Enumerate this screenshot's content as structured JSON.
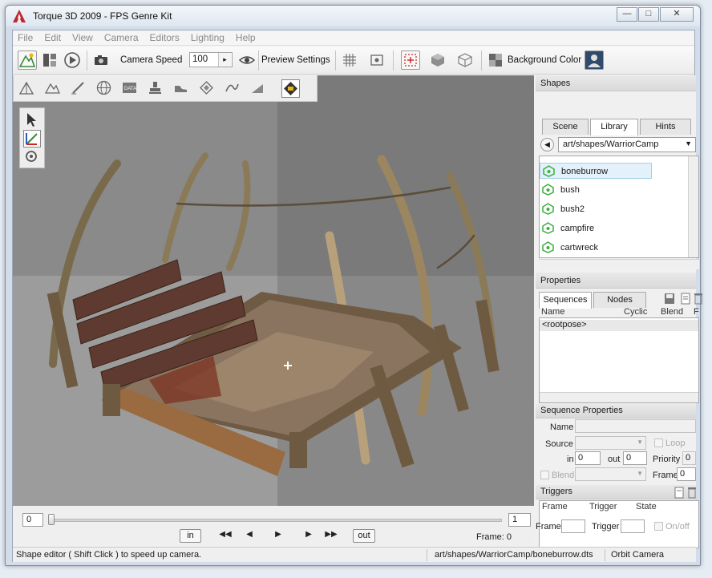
{
  "window": {
    "title": "Torque 3D 2009 - FPS Genre Kit"
  },
  "menu": [
    "File",
    "Edit",
    "View",
    "Camera",
    "Editors",
    "Lighting",
    "Help"
  ],
  "toolbar": {
    "camera_speed_label": "Camera Speed",
    "camera_speed_value": "100",
    "preview_settings_label": "Preview Settings",
    "background_color_label": "Background Color"
  },
  "shapes_panel": {
    "title": "Shapes",
    "tabs": [
      "Scene",
      "Library",
      "Hints"
    ],
    "active_tab": "Library",
    "path": "art/shapes/WarriorCamp",
    "items": [
      "boneburrow",
      "bush",
      "bush2",
      "campfire",
      "cartwreck"
    ],
    "selected": "boneburrow"
  },
  "properties_panel": {
    "title": "Properties",
    "tabs": [
      "Sequences",
      "Nodes"
    ],
    "active_tab": "Sequences",
    "columns": [
      "Name",
      "Cyclic",
      "Blend",
      "F"
    ],
    "sequences": [
      "<rootpose>"
    ]
  },
  "sequence_properties": {
    "title": "Sequence Properties",
    "name_label": "Name",
    "source_label": "Source",
    "loop_label": "Loop",
    "in_label": "in",
    "in_value": "0",
    "out_label": "out",
    "out_value": "0",
    "priority_label": "Priority",
    "priority_value": "0",
    "blend_label": "Blend",
    "frame_label": "Frame",
    "frame_value": "0"
  },
  "triggers": {
    "title": "Triggers",
    "columns": [
      "Frame",
      "Trigger",
      "State"
    ],
    "frame_label": "Frame",
    "trigger_label": "Trigger",
    "onoff_label": "On/off"
  },
  "timeline": {
    "start_frame": "0",
    "end_frame": "1",
    "in_label": "in",
    "out_label": "out",
    "frame_text": "Frame:  0"
  },
  "status": {
    "hint": "Shape editor ( Shift Click ) to speed up camera.",
    "path": "art/shapes/WarriorCamp/boneburrow.dts",
    "camera": "Orbit Camera"
  },
  "colors": {
    "viewport_bg": "#858585",
    "accent": "#3cae3c",
    "selection": "#e3f1fb"
  }
}
